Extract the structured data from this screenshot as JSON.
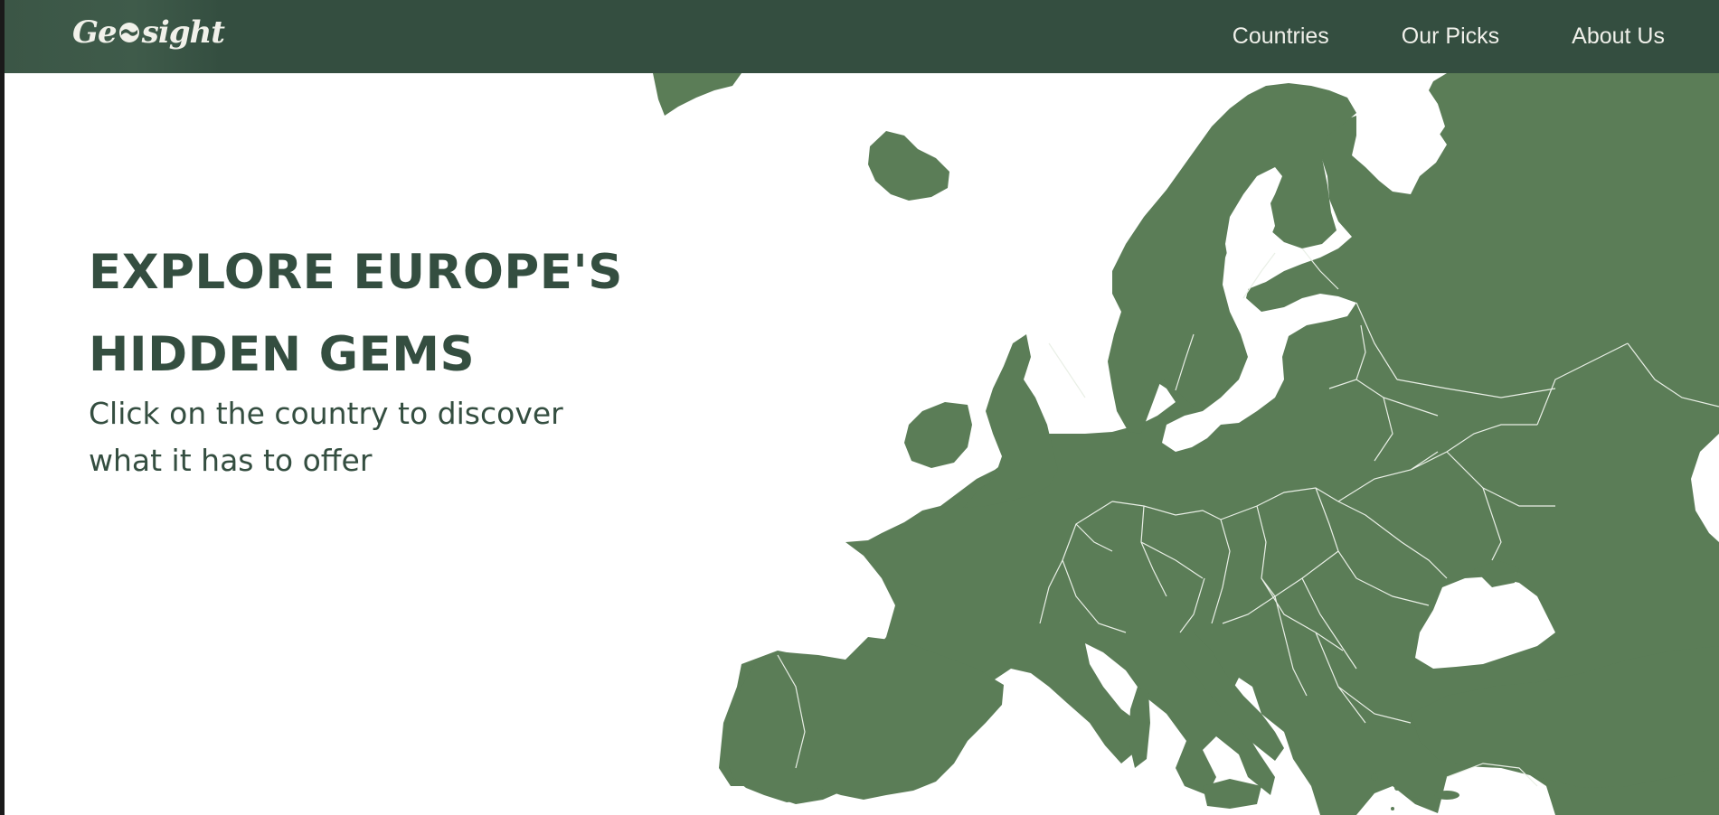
{
  "brand": {
    "logo_text_pre": "Ge",
    "logo_text_post": "sight"
  },
  "nav": {
    "links": [
      "Countries",
      "Our Picks",
      "About Us"
    ]
  },
  "hero": {
    "title": "EXPLORE EUROPE'S HIDDEN GEMS",
    "subtitle": "Click on the country to discover what it has to offer"
  },
  "colors": {
    "navbar": "#344e40",
    "map_land": "#5b7d57",
    "heading_text": "#344e40"
  }
}
